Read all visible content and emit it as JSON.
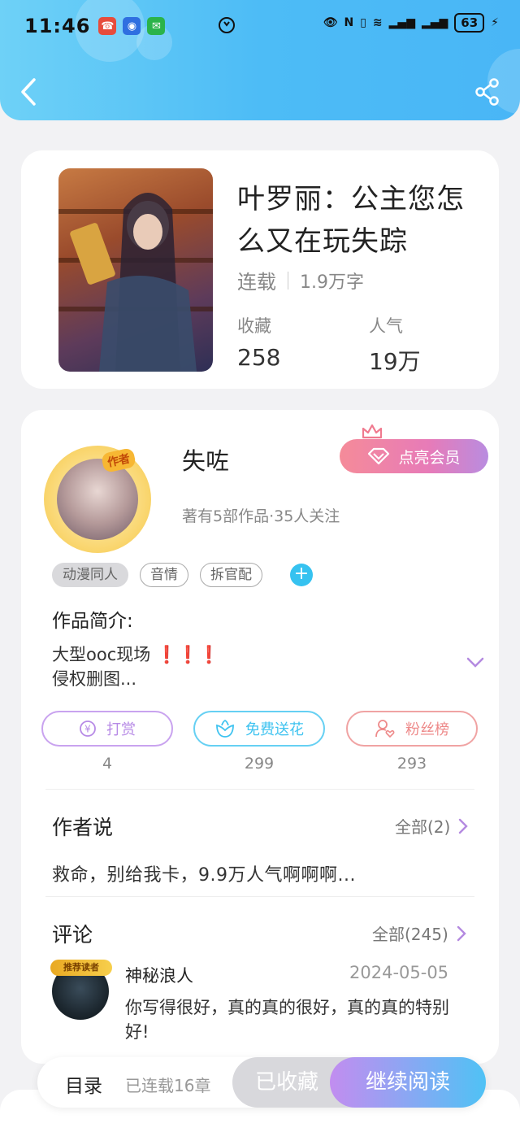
{
  "status_bar": {
    "time": "11:46",
    "battery": "63"
  },
  "book": {
    "title": "叶罗丽：公主您怎么又在玩失踪",
    "status": "连载",
    "word_count": "1.9万字",
    "stats": [
      {
        "label": "收藏",
        "value": "258"
      },
      {
        "label": "人气",
        "value": "19万"
      }
    ]
  },
  "author": {
    "name": "失咗",
    "badge": "作者",
    "info": "著有5部作品·35人关注",
    "vip_button": "点亮会员"
  },
  "tags": [
    "动漫同人",
    "音情",
    "拆官配"
  ],
  "intro": {
    "title": "作品简介:",
    "line1": "大型ooc现场",
    "marks": "❗❗❗",
    "line2": "侵权删图..."
  },
  "actions": [
    {
      "label": "打赏",
      "count": "4",
      "color": "#b78ae6"
    },
    {
      "label": "免费送花",
      "count": "299",
      "color": "#3fc3f0"
    },
    {
      "label": "粉丝榜",
      "count": "293",
      "color": "#ee8a8a"
    }
  ],
  "author_says": {
    "title": "作者说",
    "more": "全部(2)",
    "text": "救命，别给我卡，9.9万人气啊啊啊..."
  },
  "comments": {
    "title": "评论",
    "more": "全部(245)",
    "items": [
      {
        "badge": "推荐读者",
        "name": "神秘浪人",
        "date": "2024-05-05",
        "text": "你写得很好，真的真的很好，真的真的特别好!"
      }
    ]
  },
  "bottom_bar": {
    "toc": "目录",
    "serial": "已连载16章",
    "collected": "已收藏",
    "read": "继续阅读"
  }
}
